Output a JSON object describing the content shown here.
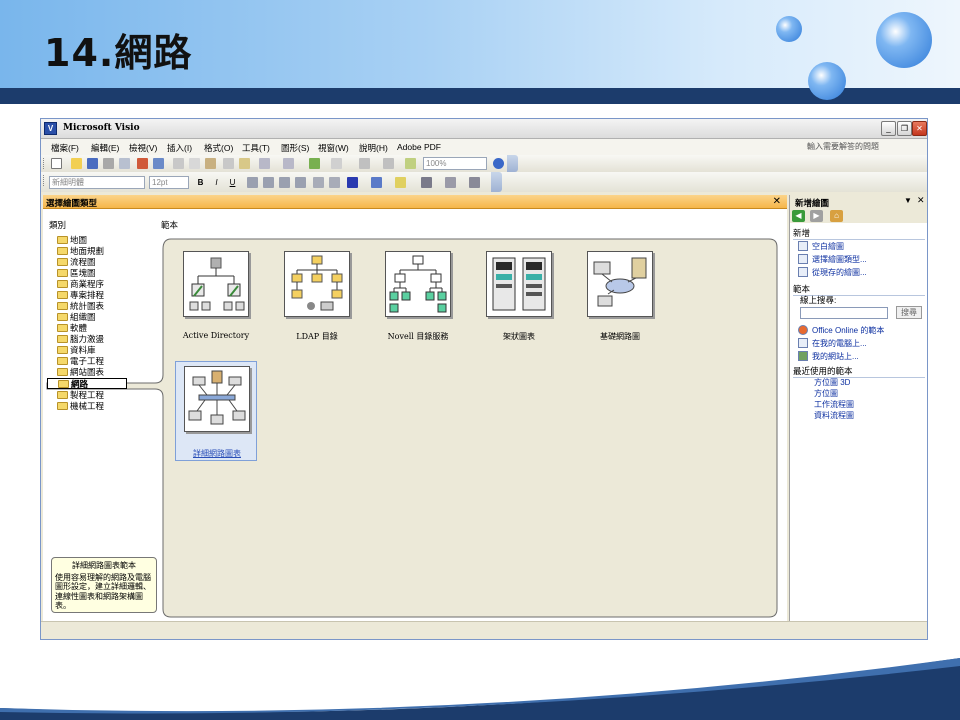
{
  "slide": {
    "title": "14.網路"
  },
  "window": {
    "title": "Microsoft Visio",
    "minimize": "_",
    "restore": "❐",
    "close": "✕"
  },
  "menu": {
    "items": [
      "檔案(F)",
      "編輯(E)",
      "檢視(V)",
      "插入(I)",
      "格式(O)",
      "工具(T)",
      "圖形(S)",
      "視窗(W)",
      "說明(H)",
      "Adobe PDF"
    ],
    "help_placeholder": "輸入需要解答的問題"
  },
  "toolbar": {
    "zoom": "100%",
    "style": "新細明體",
    "font_size": "12pt",
    "bold": "B",
    "italic": "I",
    "underline": "U"
  },
  "panel": {
    "title": "選擇繪圖類型",
    "close": "✕",
    "categories_label": "類別",
    "templates_label": "範本"
  },
  "categories": [
    "地圖",
    "地面規劃",
    "流程圖",
    "區塊圖",
    "商業程序",
    "專案排程",
    "統計圖表",
    "組織圖",
    "軟體",
    "腦力激盪",
    "資料庫",
    "電子工程",
    "網站圖表",
    "網路",
    "製程工程",
    "機械工程"
  ],
  "selected_category": "網路",
  "templates": [
    {
      "label": "Active Directory"
    },
    {
      "label": "LDAP 目錄"
    },
    {
      "label": "Novell 目錄服務"
    },
    {
      "label": "架狀圖表"
    },
    {
      "label": "基礎網路圖"
    },
    {
      "label": "詳細網路圖表"
    }
  ],
  "description": {
    "title": "詳細網路圖表範本",
    "text": "使用容易理解的網路及電腦圖形設定，建立詳細邏輯、連線性圖表和網路架構圖表。"
  },
  "task_pane": {
    "title": "新增繪圖",
    "new_label": "新增",
    "new_links": [
      "空白繪圖",
      "選擇繪圖類型...",
      "從現存的繪圖..."
    ],
    "templates_label": "範本",
    "search_label": "線上搜尋:",
    "search_button": "搜尋",
    "template_links": [
      "Office Online 的範本",
      "在我的電腦上...",
      "我的網站上..."
    ],
    "recent_label": "最近使用的範本",
    "recent_links": [
      "方位圖 3D",
      "方位圖",
      "工作流程圖",
      "資料流程圖"
    ]
  },
  "colors": {
    "header_bar": "#1c3c6c",
    "panel_header": "#f6b64a",
    "link": "#0c2fa0"
  }
}
